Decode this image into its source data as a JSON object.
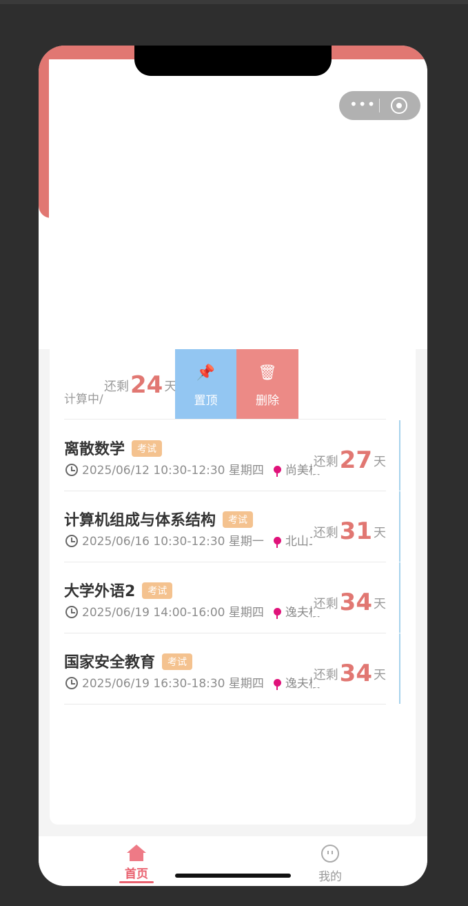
{
  "colors": {
    "accent": "#e17772",
    "tag": "#f4c28f",
    "pin_action": "#93c6f2",
    "delete_action": "#ec8a86",
    "tab_active": "#e9616f"
  },
  "swiped_item": {
    "name_fragment": "计算中/",
    "remain_prefix": "还剩",
    "days": "24",
    "remain_suffix": "天",
    "actions": {
      "pin_icon": "pushpin-icon",
      "pin_label": "置顶",
      "delete_icon": "trash-icon",
      "delete_label": "删除"
    }
  },
  "exams": [
    {
      "title": "离散数学",
      "tag": "考试",
      "datetime": "2025/06/12 10:30-12:30 星期四",
      "location": "尚美楼",
      "remain_prefix": "还剩",
      "days": "27",
      "remain_suffix": "天"
    },
    {
      "title": "计算机组成与体系结构",
      "tag": "考试",
      "datetime": "2025/06/16 10:30-12:30 星期一",
      "location": "北山二",
      "remain_prefix": "还剩",
      "days": "31",
      "remain_suffix": "天"
    },
    {
      "title": "大学外语2",
      "tag": "考试",
      "datetime": "2025/06/19 14:00-16:00 星期四",
      "location": "逸夫楼",
      "remain_prefix": "还剩",
      "days": "34",
      "remain_suffix": "天"
    },
    {
      "title": "国家安全教育",
      "tag": "考试",
      "datetime": "2025/06/19 16:30-18:30 星期四",
      "location": "逸夫楼",
      "remain_prefix": "还剩",
      "days": "34",
      "remain_suffix": "天"
    }
  ],
  "tabbar": {
    "home_label": "首页",
    "home_icon": "home-icon",
    "me_label": "我的",
    "me_icon": "face-icon"
  },
  "capsule": {
    "more_icon": "more-dots-icon",
    "close_icon": "target-icon"
  }
}
